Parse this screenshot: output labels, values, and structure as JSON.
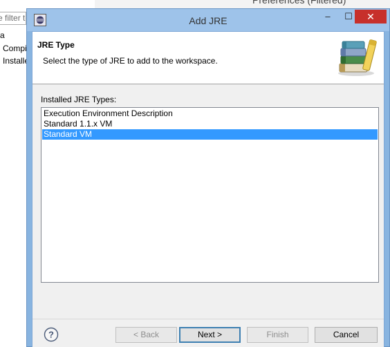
{
  "background_window": {
    "title": "Preferences (Filtered)",
    "filter_placeholder": "type filter text",
    "tree_items": [
      "a",
      "Compi",
      "Installe"
    ]
  },
  "dialog": {
    "title": "Add JRE",
    "window_controls": {
      "minimize": "–",
      "maximize": "☐",
      "close": "✕"
    },
    "header": {
      "title": "JRE Type",
      "description": "Select the type of JRE to add to the workspace."
    },
    "list_label": "Installed JRE Types:",
    "jre_types": [
      {
        "label": "Execution Environment Description",
        "selected": false
      },
      {
        "label": "Standard 1.1.x VM",
        "selected": false
      },
      {
        "label": "Standard VM",
        "selected": true
      }
    ],
    "buttons": {
      "back": "< Back",
      "next": "Next >",
      "finish": "Finish",
      "cancel": "Cancel"
    },
    "icons": {
      "title_icon": "eclipse-icon",
      "header_graphic": "library-books-icon",
      "help": "help-icon"
    }
  },
  "colors": {
    "selection": "#3399ff",
    "close_button": "#c7302b",
    "window_frame": "#9ec3ea"
  }
}
